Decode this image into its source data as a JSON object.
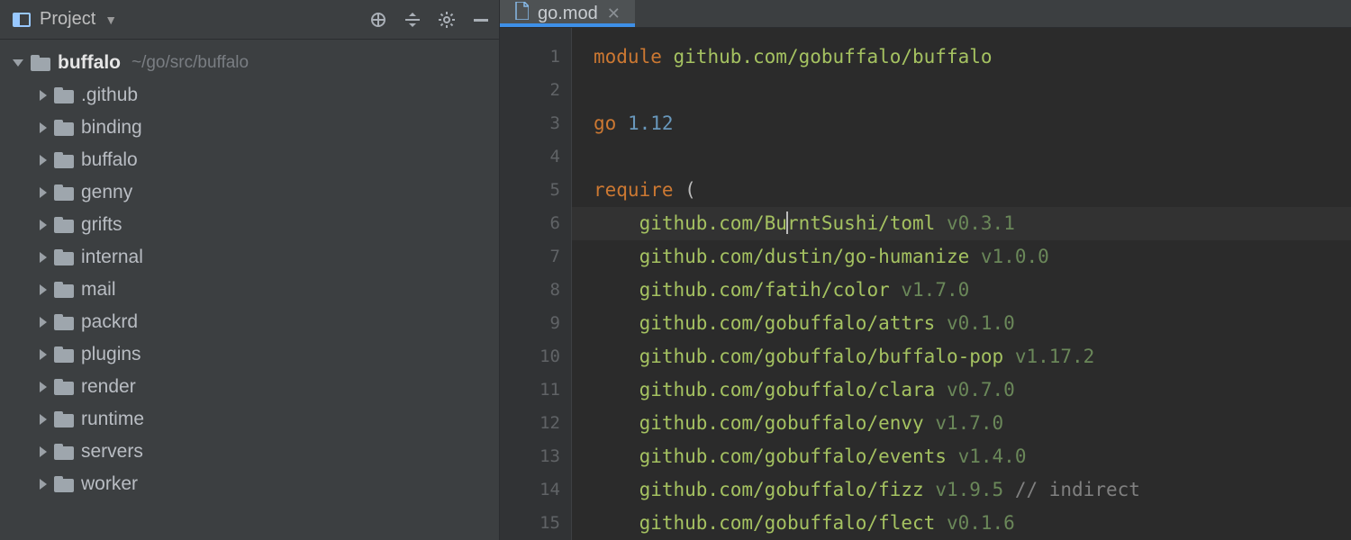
{
  "sidebar": {
    "panel_label": "Project",
    "root": {
      "name": "buffalo",
      "path": "~/go/src/buffalo"
    },
    "items": [
      {
        "label": ".github"
      },
      {
        "label": "binding"
      },
      {
        "label": "buffalo"
      },
      {
        "label": "genny"
      },
      {
        "label": "grifts"
      },
      {
        "label": "internal"
      },
      {
        "label": "mail"
      },
      {
        "label": "packrd"
      },
      {
        "label": "plugins"
      },
      {
        "label": "render"
      },
      {
        "label": "runtime"
      },
      {
        "label": "servers"
      },
      {
        "label": "worker"
      }
    ]
  },
  "tab": {
    "filename": "go.mod"
  },
  "editor": {
    "module_kw": "module",
    "module_name": "github.com/gobuffalo/buffalo",
    "go_kw": "go",
    "go_version": "1.12",
    "require_kw": "require",
    "paren_open": "(",
    "cursor_dep_pre": "github.com/Bu",
    "cursor_dep_post": "rntSushi/toml",
    "cursor_ver": "v0.3.1",
    "deps": [
      {
        "pkg": "github.com/dustin/go-humanize",
        "ver": "v1.0.0"
      },
      {
        "pkg": "github.com/fatih/color",
        "ver": "v1.7.0"
      },
      {
        "pkg": "github.com/gobuffalo/attrs",
        "ver": "v0.1.0"
      },
      {
        "pkg": "github.com/gobuffalo/buffalo-pop",
        "ver": "v1.17.2"
      },
      {
        "pkg": "github.com/gobuffalo/clara",
        "ver": "v0.7.0"
      },
      {
        "pkg": "github.com/gobuffalo/envy",
        "ver": "v1.7.0"
      },
      {
        "pkg": "github.com/gobuffalo/events",
        "ver": "v1.4.0"
      },
      {
        "pkg": "github.com/gobuffalo/fizz",
        "ver": "v1.9.5",
        "comment": " // indirect"
      },
      {
        "pkg": "github.com/gobuffalo/flect",
        "ver": "v0.1.6"
      }
    ],
    "line_numbers": [
      "1",
      "2",
      "3",
      "4",
      "5",
      "6",
      "7",
      "8",
      "9",
      "10",
      "11",
      "12",
      "13",
      "14",
      "15"
    ]
  }
}
